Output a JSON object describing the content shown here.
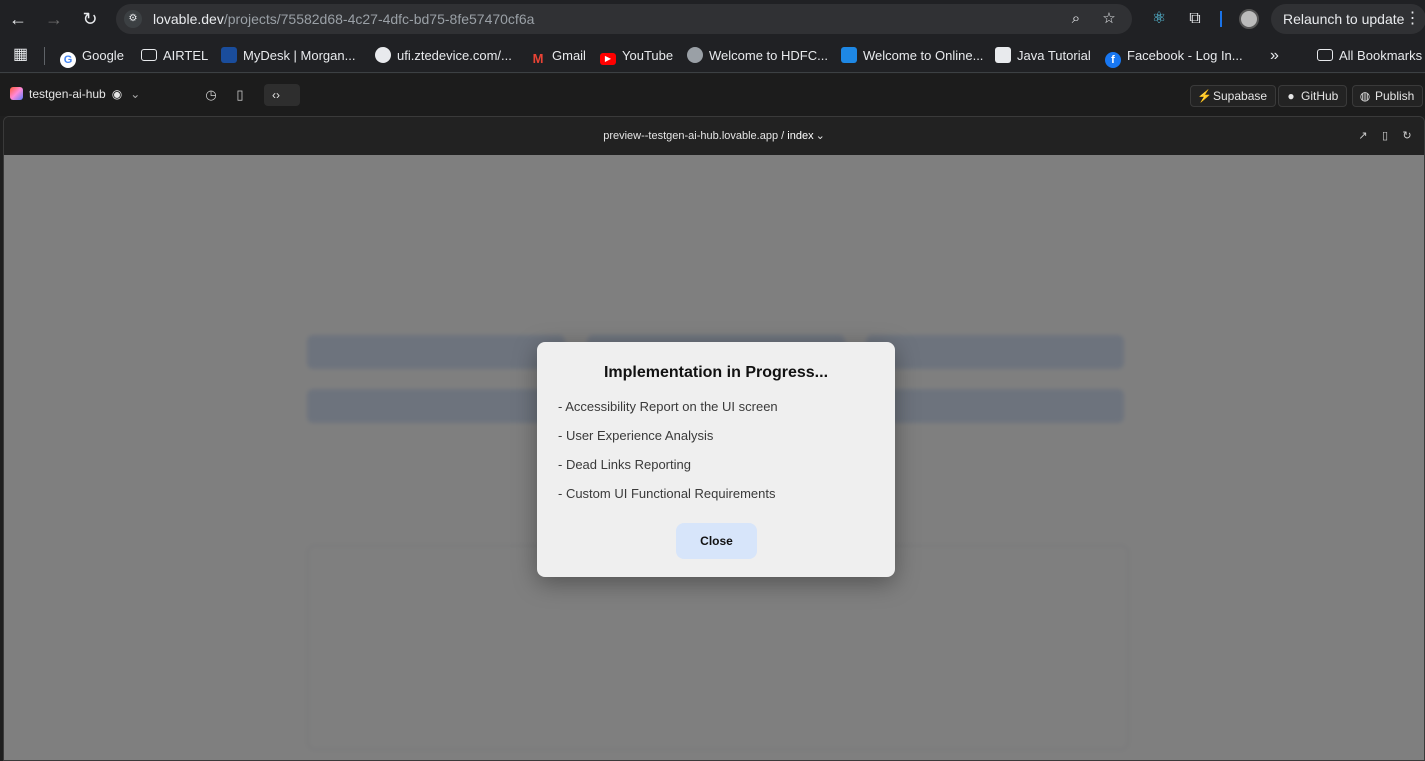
{
  "browser": {
    "url_host": "lovable.dev",
    "url_path": "/projects/75582d68-4c27-4dfc-bd75-8fe57470cf6a",
    "relaunch_label": "Relaunch to update"
  },
  "bookmarks": {
    "items": [
      {
        "label": "Google",
        "icon": "google-icon"
      },
      {
        "label": "AIRTEL",
        "icon": "folder-icon"
      },
      {
        "label": "MyDesk | Morgan...",
        "icon": "morgan-icon"
      },
      {
        "label": "ufi.ztedevice.com/...",
        "icon": "globe-icon"
      },
      {
        "label": "Gmail",
        "icon": "gmail-icon"
      },
      {
        "label": "YouTube",
        "icon": "youtube-icon"
      },
      {
        "label": "Welcome to HDFC...",
        "icon": "globe-icon"
      },
      {
        "label": "Welcome to Online...",
        "icon": "globe-icon"
      },
      {
        "label": "Java Tutorial",
        "icon": "java-icon"
      },
      {
        "label": "Facebook - Log In...",
        "icon": "facebook-icon"
      }
    ],
    "more_label": "»",
    "all_bookmarks_label": "All Bookmarks"
  },
  "app_header": {
    "project_name": "testgen-ai-hub",
    "supabase_label": "Supabase",
    "github_label": "GitHub",
    "publish_label": "Publish"
  },
  "preview": {
    "host": "preview--testgen-ai-hub.lovable.app",
    "separator": "/",
    "route": "index"
  },
  "modal": {
    "title": "Implementation in Progress...",
    "items": [
      "- Accessibility Report on the UI screen",
      "- User Experience Analysis",
      "- Dead Links Reporting",
      "- Custom UI Functional Requirements"
    ],
    "close_label": "Close"
  },
  "colors": {
    "accent": "#d7e5fa",
    "browser_chrome": "#202124",
    "app_header": "#1c1c1c"
  }
}
